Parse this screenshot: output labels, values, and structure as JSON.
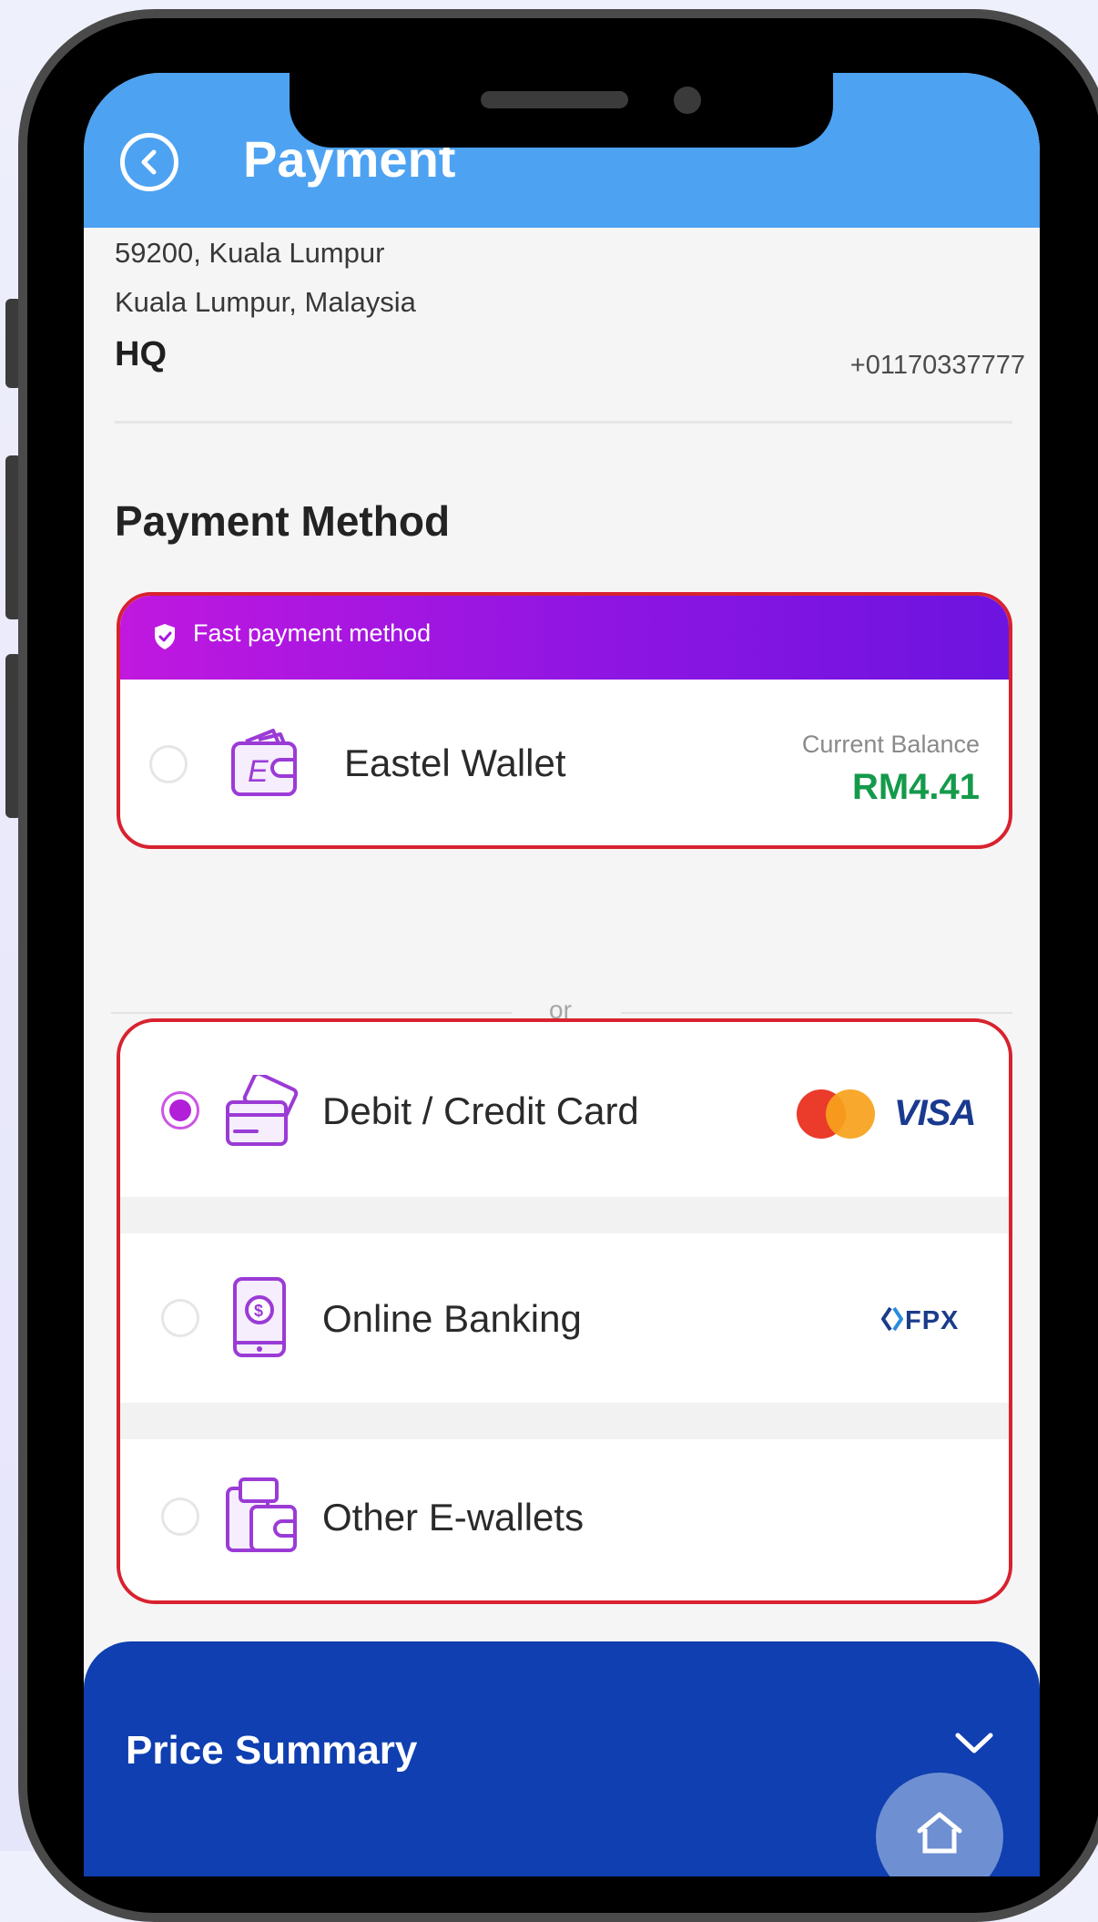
{
  "header": {
    "title": "Payment",
    "back_icon": "chevron-left-circle-icon"
  },
  "address": {
    "line1": "59200, Kuala Lumpur",
    "line2": "Kuala Lumpur, Malaysia",
    "label": "HQ",
    "phone": "+01170337777"
  },
  "payment_method": {
    "title": "Payment Method",
    "fast_badge": "Fast payment method",
    "wallet": {
      "name": "Eastel Wallet",
      "icon": "wallet-icon",
      "selected": false,
      "balance_label": "Current Balance",
      "balance": "RM4.41"
    },
    "separator": "or",
    "options": [
      {
        "label": "Debit / Credit Card",
        "icon": "credit-card-icon",
        "selected": true,
        "brand": "VISA"
      },
      {
        "label": "Online Banking",
        "icon": "mobile-banking-icon",
        "selected": false,
        "brand": "FPX"
      },
      {
        "label": "Other E-wallets",
        "icon": "e-wallet-icon",
        "selected": false
      }
    ]
  },
  "price_summary": {
    "title": "Price Summary",
    "toggle_icon": "chevron-down-icon"
  },
  "colors": {
    "header": "#4da2f2",
    "accent": "#b120d8",
    "balance": "#149a4b",
    "summary": "#0f3fb0",
    "highlight_border": "#d8222f"
  }
}
